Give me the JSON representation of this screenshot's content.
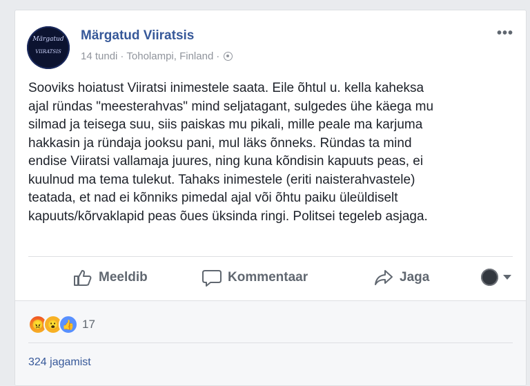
{
  "post": {
    "page_name": "Märgatud Viiratsis",
    "avatar_text_top": "Märgatud",
    "avatar_text_bottom": "VIIRATSIS",
    "time": "14 tundi",
    "location": "Toholampi, Finland",
    "separator": "·",
    "more": "•••",
    "text_lines": [
      "Sooviks hoiatust Viiratsi inimestele saata. Eile õhtul u. kella kaheksa",
      "ajal ründas \"meesterahvas\" mind seljatagant, sulgedes ühe käega mu",
      "silmad ja teisega suu, siis paiskas mu pikali, mille peale ma karjuma",
      "hakkasin ja ründaja jooksu pani, mul läks õnneks. Ründas ta mind",
      "endise Viiratsi vallamaja juures, ning kuna kõndisin kapuuts peas, ei",
      "kuulnud ma tema tulekut. Tahaks inimestele (eriti naisterahvastele)",
      "teatada, et nad ei kõnniks pimedal ajal või õhtu paiku üleüldiselt",
      "kapuuts/kõrvaklapid peas õues üksinda ringi. Politsei tegeleb asjaga."
    ]
  },
  "actions": {
    "like": "Meeldib",
    "comment": "Kommentaar",
    "share": "Jaga"
  },
  "stats": {
    "reaction_count": "17",
    "shares": "324 jagamist"
  },
  "colors": {
    "link": "#365899",
    "muted": "#606770",
    "text": "#1d2129"
  }
}
